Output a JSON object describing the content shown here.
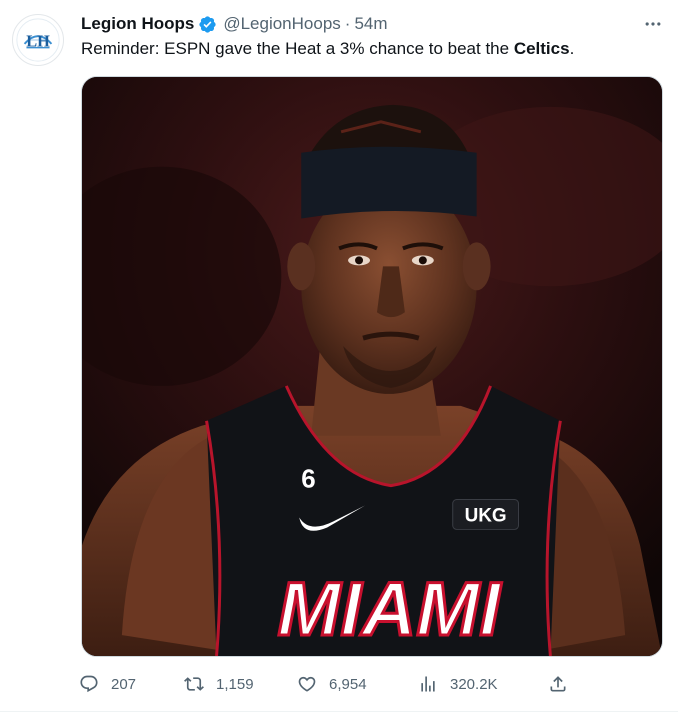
{
  "tweet": {
    "author": {
      "display_name": "Legion Hoops",
      "handle": "@LegionHoops",
      "verified": true,
      "avatar_text": "LH",
      "avatar_icon": "legion-hoops-logo"
    },
    "separator": "·",
    "time": "54m",
    "text": {
      "before": "Reminder: ESPN gave the Heat a 3% chance to beat the ",
      "bold": "Celtics",
      "after": "."
    },
    "media": {
      "jersey_number": "6",
      "jersey_text": "MIAMI",
      "sponsor_patch": "UKG"
    },
    "actions": {
      "reply_count": "207",
      "retweet_count": "1,159",
      "like_count": "6,954",
      "views_count": "320.2K"
    }
  },
  "colors": {
    "text_primary": "#0f1419",
    "text_secondary": "#536471",
    "verified_blue": "#1d9bf0",
    "heat_red": "#c8102e"
  }
}
